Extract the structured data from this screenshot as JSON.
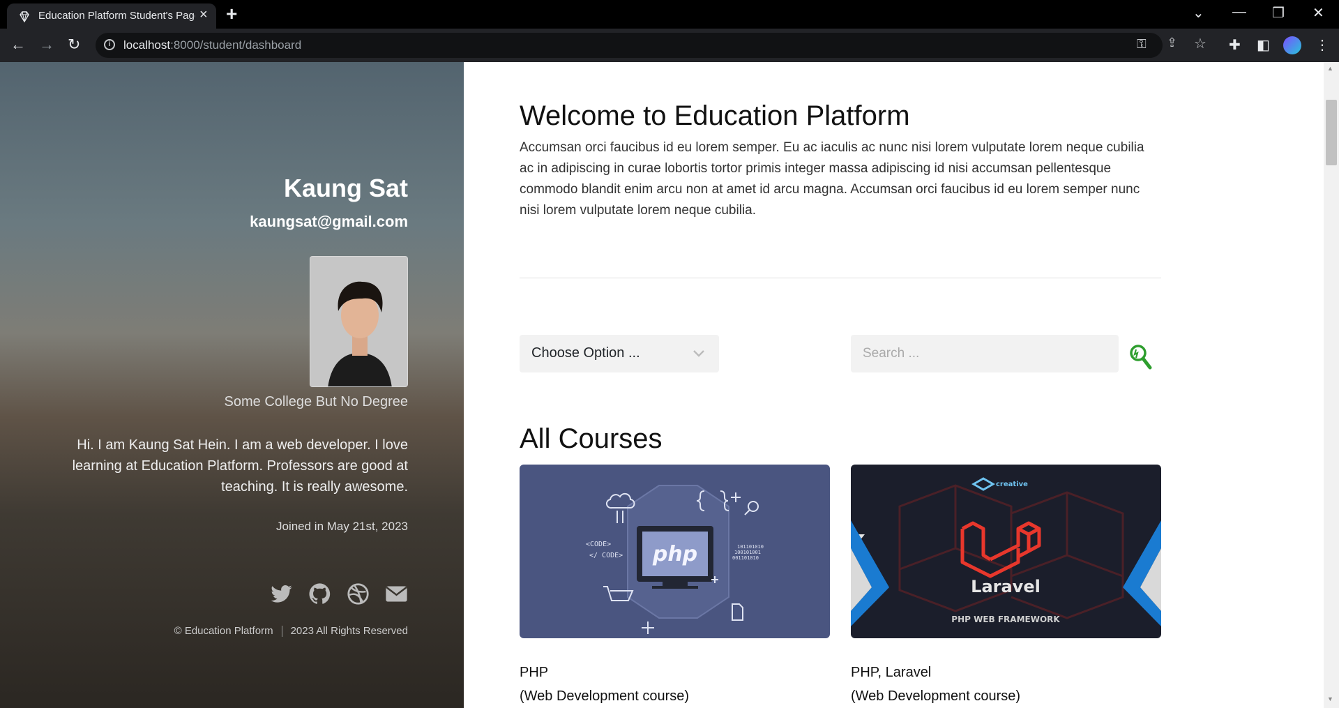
{
  "browser": {
    "tab_title": "Education Platform Student's Page",
    "new_tab": "+",
    "url_host": "localhost",
    "url_rest": ":8000/student/dashboard"
  },
  "sidebar": {
    "name": "Kaung Sat",
    "email": "kaungsat@gmail.com",
    "education": "Some College But No Degree",
    "bio": "Hi. I am Kaung Sat Hein. I am a web developer. I love learning at Education Platform. Professors are good at teaching. It is really awesome.",
    "joined": "Joined in May 21st, 2023",
    "social": [
      "twitter-icon",
      "github-icon",
      "dribbble-icon",
      "envelope-icon"
    ],
    "footer_brand": "© Education Platform",
    "footer_rights": "2023 All Rights Reserved"
  },
  "main": {
    "welcome": "Welcome to Education Platform",
    "intro": "Accumsan orci faucibus id eu lorem semper. Eu ac iaculis ac nunc nisi lorem vulputate lorem neque cubilia ac in adipiscing in curae lobortis tortor primis integer massa adipiscing id nisi accumsan pellentesque commodo blandit enim arcu non at amet id arcu magna. Accumsan orci faucibus id eu lorem semper nunc nisi lorem vulputate lorem neque cubilia.",
    "filter_selected": "Choose Option ...",
    "search_placeholder": "Search ...",
    "courses_title": "All Courses",
    "courses": [
      {
        "name": "PHP",
        "type": "(Web Development course)",
        "thumb_text": "php"
      },
      {
        "name": "PHP, Laravel",
        "type": "(Web Development course)",
        "thumb_text": "Laravel",
        "thumb_sub": "PHP WEB FRAMEWORK",
        "thumb_brand": "creative"
      }
    ]
  },
  "colors": {
    "accent_search": "#2e9e2e",
    "php_thumb_bg": "#4a5580",
    "laravel_thumb_bg": "#1b1e2b",
    "laravel_red": "#e8372c"
  }
}
